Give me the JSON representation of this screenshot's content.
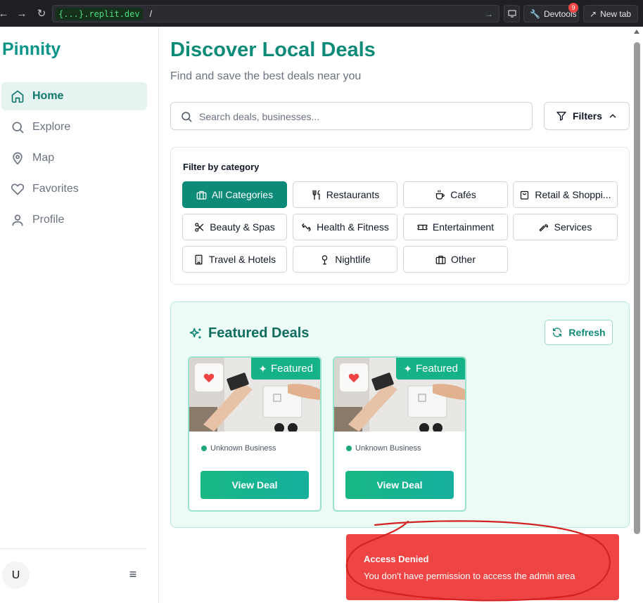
{
  "browser": {
    "url_host": "{...}.replit.dev",
    "url_path": "/",
    "devtools_label": "Devtools",
    "devtools_badge": "9",
    "newtab_label": "New tab"
  },
  "sidebar": {
    "brand": "Pinnity",
    "items": [
      {
        "label": "Home",
        "icon": "home-icon",
        "active": true
      },
      {
        "label": "Explore",
        "icon": "search-icon",
        "active": false
      },
      {
        "label": "Map",
        "icon": "map-pin-icon",
        "active": false
      },
      {
        "label": "Favorites",
        "icon": "heart-icon",
        "active": false
      },
      {
        "label": "Profile",
        "icon": "user-icon",
        "active": false
      }
    ],
    "avatar_initial": "U"
  },
  "main": {
    "title": "Discover Local Deals",
    "subtitle": "Find and save the best deals near you",
    "search_placeholder": "Search deals, businesses...",
    "filters_label": "Filters",
    "category_title": "Filter by category",
    "categories": [
      {
        "label": "All Categories",
        "icon": "briefcase-icon",
        "active": true
      },
      {
        "label": "Restaurants",
        "icon": "utensils-icon",
        "active": false
      },
      {
        "label": "Cafés",
        "icon": "coffee-icon",
        "active": false
      },
      {
        "label": "Retail & Shoppi...",
        "icon": "shopping-bag-icon",
        "active": false
      },
      {
        "label": "Beauty & Spas",
        "icon": "scissors-icon",
        "active": false
      },
      {
        "label": "Health & Fitness",
        "icon": "dumbbell-icon",
        "active": false
      },
      {
        "label": "Entertainment",
        "icon": "ticket-icon",
        "active": false
      },
      {
        "label": "Services",
        "icon": "wrench-icon",
        "active": false
      },
      {
        "label": "Travel & Hotels",
        "icon": "building-icon",
        "active": false
      },
      {
        "label": "Nightlife",
        "icon": "mic-icon",
        "active": false
      },
      {
        "label": "Other",
        "icon": "briefcase-icon",
        "active": false
      }
    ],
    "featured": {
      "title": "Featured Deals",
      "refresh_label": "Refresh",
      "deals": [
        {
          "badge": "Featured",
          "business": "Unknown Business",
          "button": "View Deal"
        },
        {
          "badge": "Featured",
          "business": "Unknown Business",
          "button": "View Deal"
        }
      ]
    }
  },
  "toast": {
    "title": "Access Denied",
    "message": "You don't have permission to access the admin area"
  },
  "colors": {
    "brand": "#0d8a78",
    "toast": "#ef4444",
    "featured_bg": "#ecfbf5"
  }
}
